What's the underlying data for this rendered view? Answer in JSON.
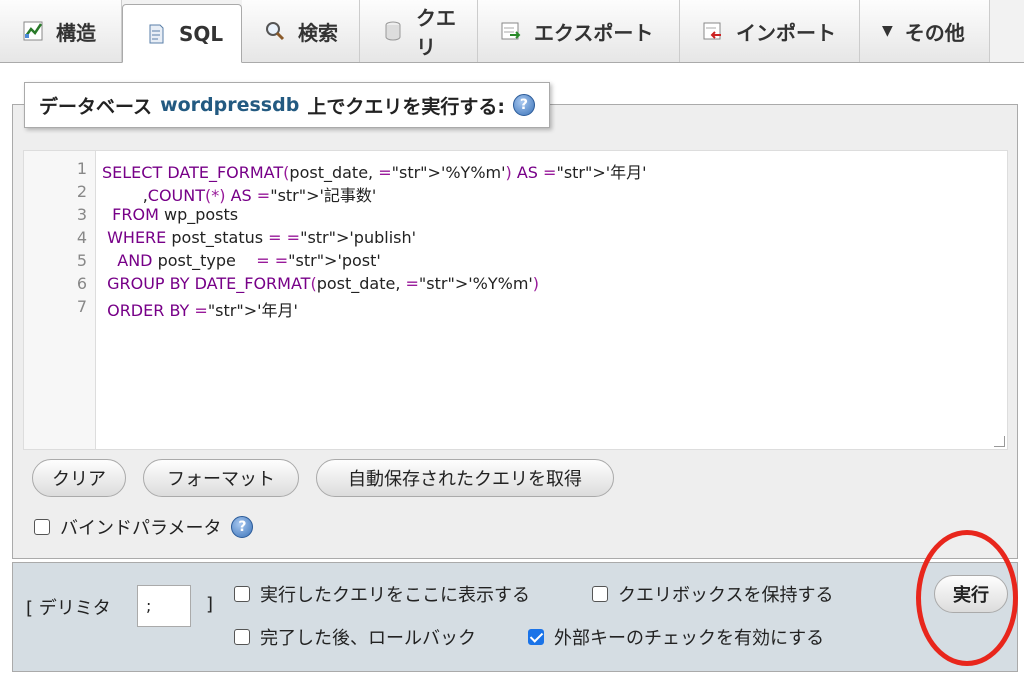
{
  "tabs": [
    {
      "label": "構造",
      "icon": "structure-icon"
    },
    {
      "label": "SQL",
      "icon": "sql-icon"
    },
    {
      "label": "検索",
      "icon": "search-icon"
    },
    {
      "label": "クエリ",
      "icon": "query-icon"
    },
    {
      "label": "エクスポート",
      "icon": "export-icon"
    },
    {
      "label": "インポート",
      "icon": "import-icon"
    },
    {
      "label": "その他",
      "icon": "chevron-down-icon"
    }
  ],
  "legend": {
    "prefix": "データベース",
    "db": "wordpressdb",
    "suffix": "上でクエリを実行する:"
  },
  "editor": {
    "line_numbers": [
      "1",
      "2",
      "3",
      "4",
      "5",
      "6",
      "7"
    ],
    "lines": [
      "SELECT DATE_FORMAT(post_date, '%Y%m') AS '年月'",
      "        ,COUNT(*) AS '記事数'",
      "  FROM wp_posts",
      " WHERE post_status = 'publish'",
      "   AND post_type    = 'post'",
      " GROUP BY DATE_FORMAT(post_date, '%Y%m')",
      " ORDER BY '年月'"
    ]
  },
  "buttons": {
    "clear": "クリア",
    "format": "フォーマット",
    "load_saved": "自動保存されたクエリを取得",
    "execute": "実行"
  },
  "bind_params": {
    "label": "バインドパラメータ",
    "checked": false
  },
  "bottom": {
    "delimiter_label": "[ デリミタ",
    "delimiter_close": "]",
    "delimiter_value": ";",
    "show_query_label": "実行したクエリをここに表示する",
    "retain_box_label": "クエリボックスを保持する",
    "rollback_label": "完了した後、ロールバック",
    "fk_check_label": "外部キーのチェックを有効にする",
    "fk_check_checked": true
  },
  "colors": {
    "keyword": "#770088",
    "string": "#aa1111",
    "highlight_circle": "#e8261c",
    "checkbox_checked": "#1a73e8"
  }
}
